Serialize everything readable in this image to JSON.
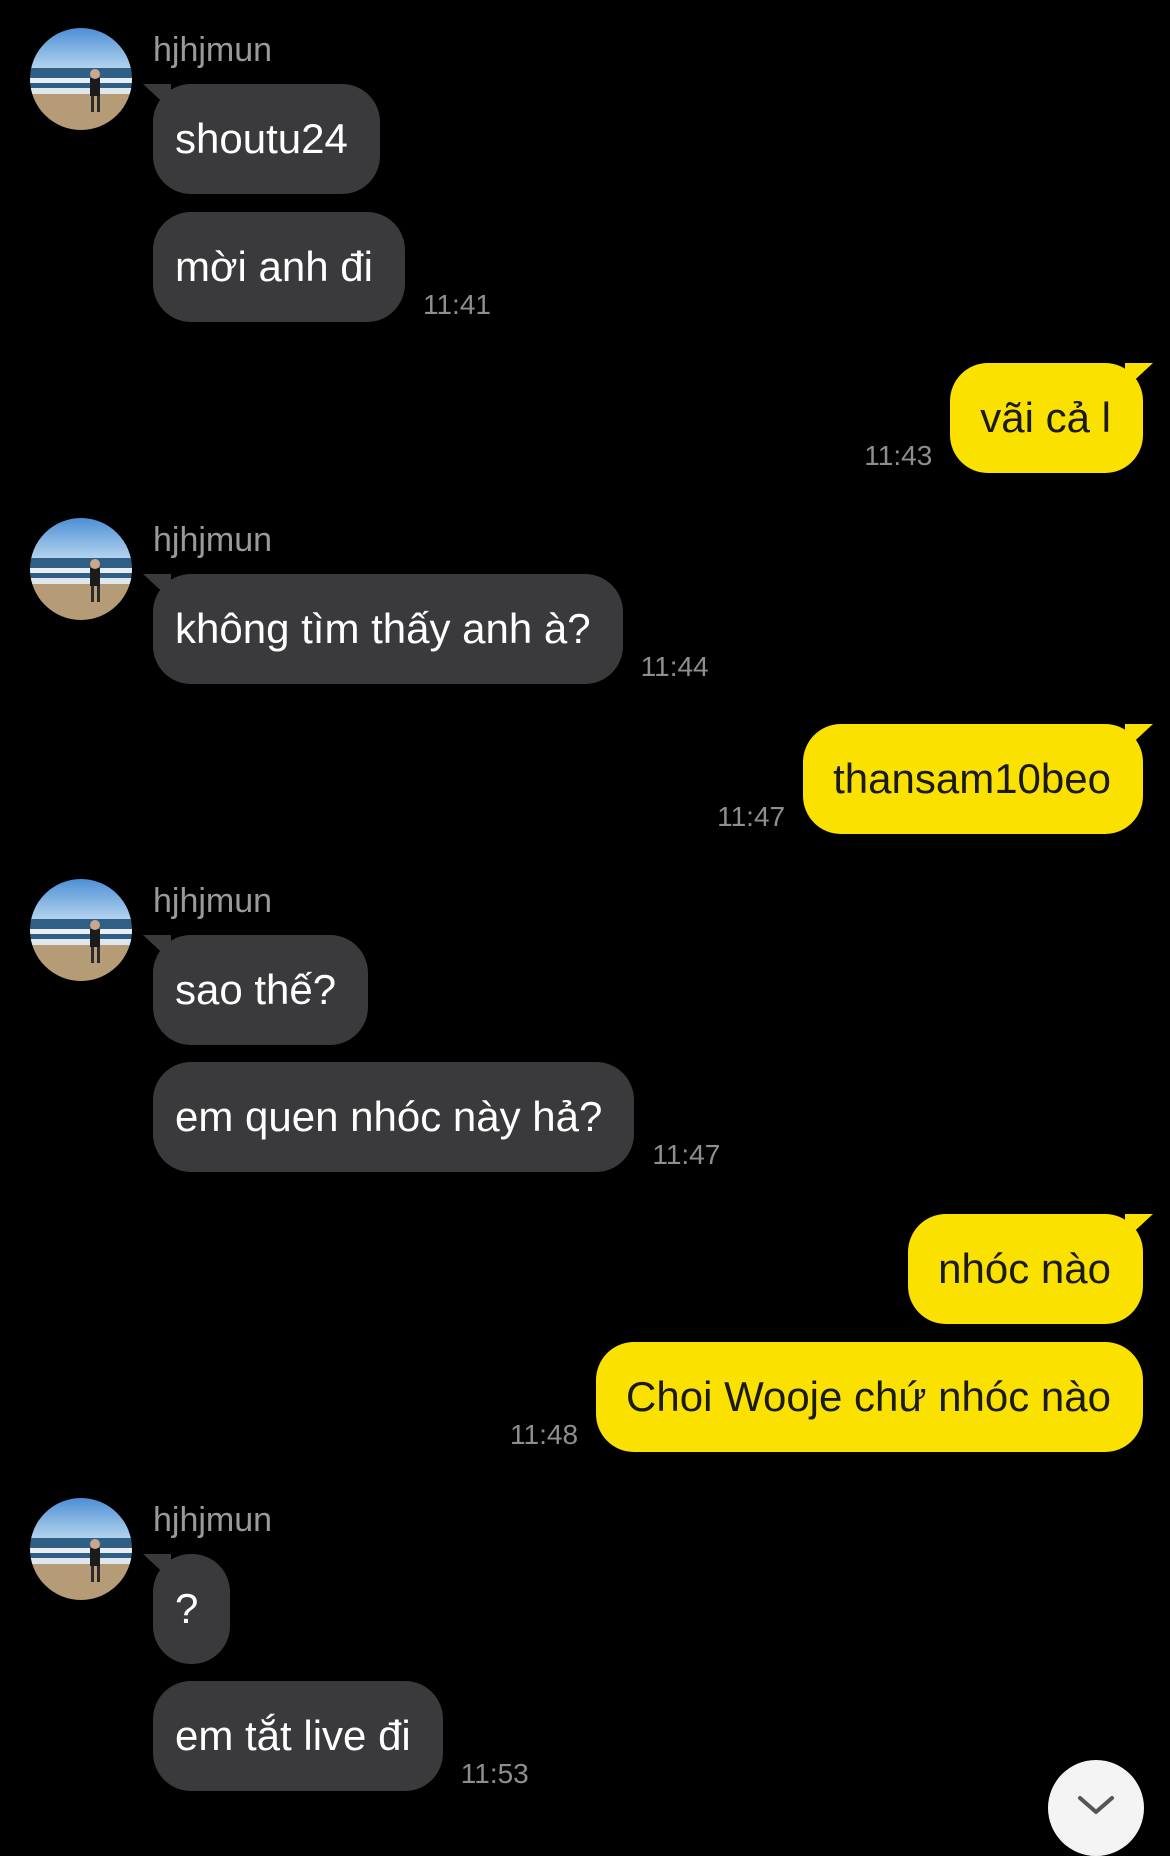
{
  "conversation": {
    "sender_name": "hjhjmun",
    "groups": [
      {
        "side": "in",
        "sender": "hjhjmun",
        "messages": [
          {
            "text": "shoutu24",
            "time": ""
          },
          {
            "text": "mời anh đi",
            "time": "11:41"
          }
        ]
      },
      {
        "side": "out",
        "messages": [
          {
            "text": "vãi cả l",
            "time": "11:43"
          }
        ]
      },
      {
        "side": "in",
        "sender": "hjhjmun",
        "messages": [
          {
            "text": "không tìm thấy anh à?",
            "time": "11:44"
          }
        ]
      },
      {
        "side": "out",
        "messages": [
          {
            "text": "thansam10beo",
            "time": "11:47"
          }
        ]
      },
      {
        "side": "in",
        "sender": "hjhjmun",
        "messages": [
          {
            "text": "sao thế?",
            "time": ""
          },
          {
            "text": "em quen nhóc này hả?",
            "time": "11:47"
          }
        ]
      },
      {
        "side": "out",
        "messages": [
          {
            "text": "nhóc nào",
            "time": ""
          },
          {
            "text": "Choi Wooje chứ nhóc nào",
            "time": "11:48"
          }
        ]
      },
      {
        "side": "in",
        "sender": "hjhjmun",
        "messages": [
          {
            "text": "?",
            "time": ""
          },
          {
            "text": "em tắt live đi",
            "time": "11:53"
          }
        ]
      }
    ]
  },
  "controls": {
    "scroll_down_icon": "chevron-down-icon"
  },
  "colors": {
    "background": "#000000",
    "incoming_bubble": "#3a3a3c",
    "outgoing_bubble": "#fae100",
    "timestamp": "#8e8e8e",
    "sender_name": "#9a9a9a"
  }
}
